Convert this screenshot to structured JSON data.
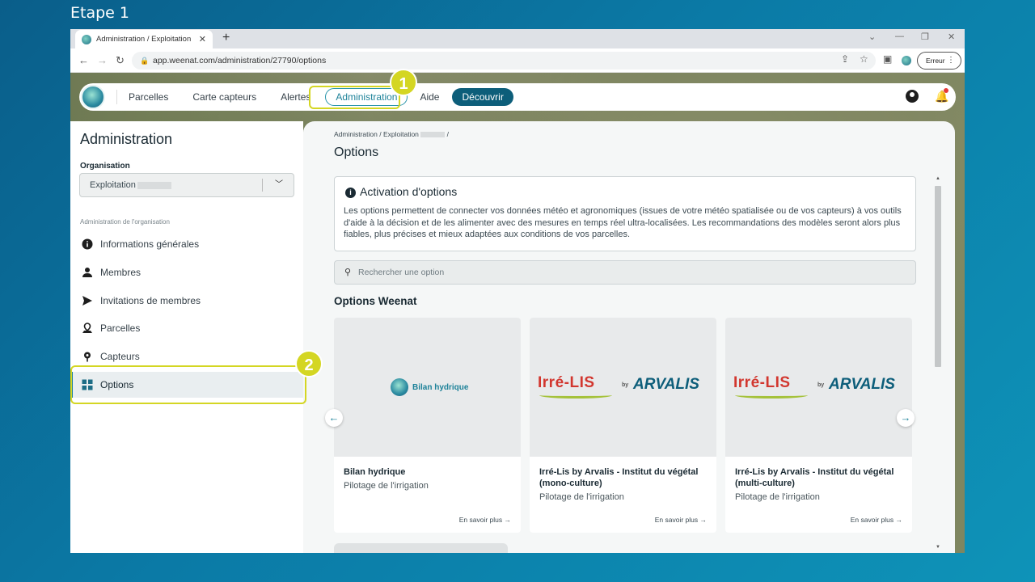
{
  "step": {
    "title": "Etape 1"
  },
  "browser": {
    "tab_title": "Administration / Exploitation",
    "tab_close": "✕",
    "new_tab": "+",
    "url": "app.weenat.com/administration/27790/options",
    "error_label": "Erreur"
  },
  "topnav": {
    "items": [
      "Parcelles",
      "Carte capteurs",
      "Alertes"
    ],
    "admin": "Administration",
    "aide": "Aide",
    "discover": "Découvrir"
  },
  "annotations": {
    "one": "1",
    "two": "2"
  },
  "sidebar": {
    "title": "Administration",
    "org_label": "Organisation",
    "org_value": "Exploitation",
    "section": "Administration de l'organisation",
    "items": [
      {
        "label": "Informations générales",
        "icon": "info-icon"
      },
      {
        "label": "Membres",
        "icon": "person-icon"
      },
      {
        "label": "Invitations de membres",
        "icon": "send-icon"
      },
      {
        "label": "Parcelles",
        "icon": "map-pin-icon"
      },
      {
        "label": "Capteurs",
        "icon": "sensor-icon"
      },
      {
        "label": "Options",
        "icon": "grid-icon",
        "active": true
      }
    ]
  },
  "main": {
    "breadcrumb_a": "Administration",
    "breadcrumb_b": "Exploitation",
    "title": "Options",
    "info_title": "Activation d'options",
    "info_text": "Les options permettent de connecter vos données météo et agronomiques (issues de votre météo spatialisée ou de vos capteurs) à vos outils d'aide à la décision et de les alimenter avec des mesures en temps réel ultra-localisées. Les recommandations des modèles seront alors plus fiables, plus précises et mieux adaptées aux conditions de vos parcelles.",
    "search_placeholder": "Rechercher une option",
    "section_title": "Options Weenat",
    "cards": [
      {
        "logo": "Bilan hydrique",
        "name": "Bilan hydrique",
        "sub": "Pilotage de l'irrigation",
        "more": "En savoir plus →"
      },
      {
        "logo_a": "Irré-LIS",
        "logo_by": "by",
        "logo_b": "ARVALIS",
        "name": "Irré-Lis by Arvalis - Institut du végétal (mono-culture)",
        "sub": "Pilotage de l'irrigation",
        "more": "En savoir plus →"
      },
      {
        "logo_a": "Irré-LIS",
        "logo_by": "by",
        "logo_b": "ARVALIS",
        "name": "Irré-Lis by Arvalis - Institut du végétal (multi-culture)",
        "sub": "Pilotage de l'irrigation",
        "more": "En savoir plus →"
      }
    ],
    "arrow_prev": "←",
    "arrow_next": "→"
  },
  "colors": {
    "accent": "#1d8299",
    "highlight": "#d4d623",
    "primary_dark": "#0d5e7a"
  }
}
